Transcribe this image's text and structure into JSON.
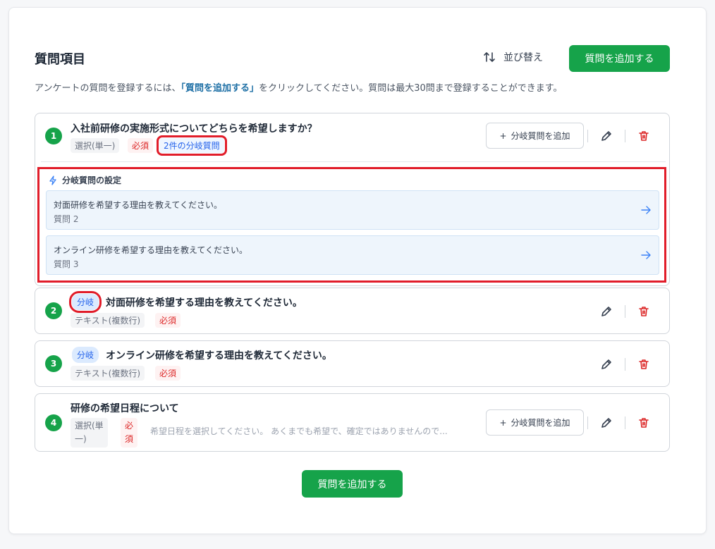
{
  "header": {
    "title": "質問項目",
    "sort_label": "並び替え",
    "add_label": "質問を追加する",
    "desc_before": "アンケートの質問を登録するには、",
    "desc_highlight": "「質問を追加する」",
    "desc_after": "をクリックしてください。質問は最大30問まで登録することができます。"
  },
  "questions": [
    {
      "number": "1",
      "title": "入社前研修の実施形式についてどちらを希望しますか？",
      "type": "選択(単一)",
      "required": "必須",
      "branch_count": "2件の分岐質問",
      "branch_add_label": "分岐質問を追加"
    },
    {
      "number": "2",
      "badge": "分岐",
      "title": "対面研修を希望する理由を教えてください。",
      "type": "テキスト(複数行)",
      "required": "必須"
    },
    {
      "number": "3",
      "badge": "分岐",
      "title": "オンライン研修を希望する理由を教えてください。",
      "type": "テキスト(複数行)",
      "required": "必須"
    },
    {
      "number": "4",
      "title": "研修の希望日程について",
      "type_line1": "選択(単",
      "type_line2": "一)",
      "required_line1": "必",
      "required_line2": "須",
      "hint": "希望日程を選択してください。 あくまでも希望で、確定ではありませんので...",
      "branch_add_label": "分岐質問を追加"
    }
  ],
  "branch_panel": {
    "title": "分岐質問の設定",
    "items": [
      {
        "text": "対面研修を希望する理由を教えてください。",
        "sub": "質問 2"
      },
      {
        "text": "オンライン研修を希望する理由を教えてください。",
        "sub": "質問 3"
      }
    ]
  },
  "footer": {
    "add_label": "質問を追加する"
  },
  "colors": {
    "accent_green": "#16a34a",
    "danger_red": "#dc2626",
    "link_blue": "#1d6fa5",
    "highlight_red": "#e11d2a"
  }
}
